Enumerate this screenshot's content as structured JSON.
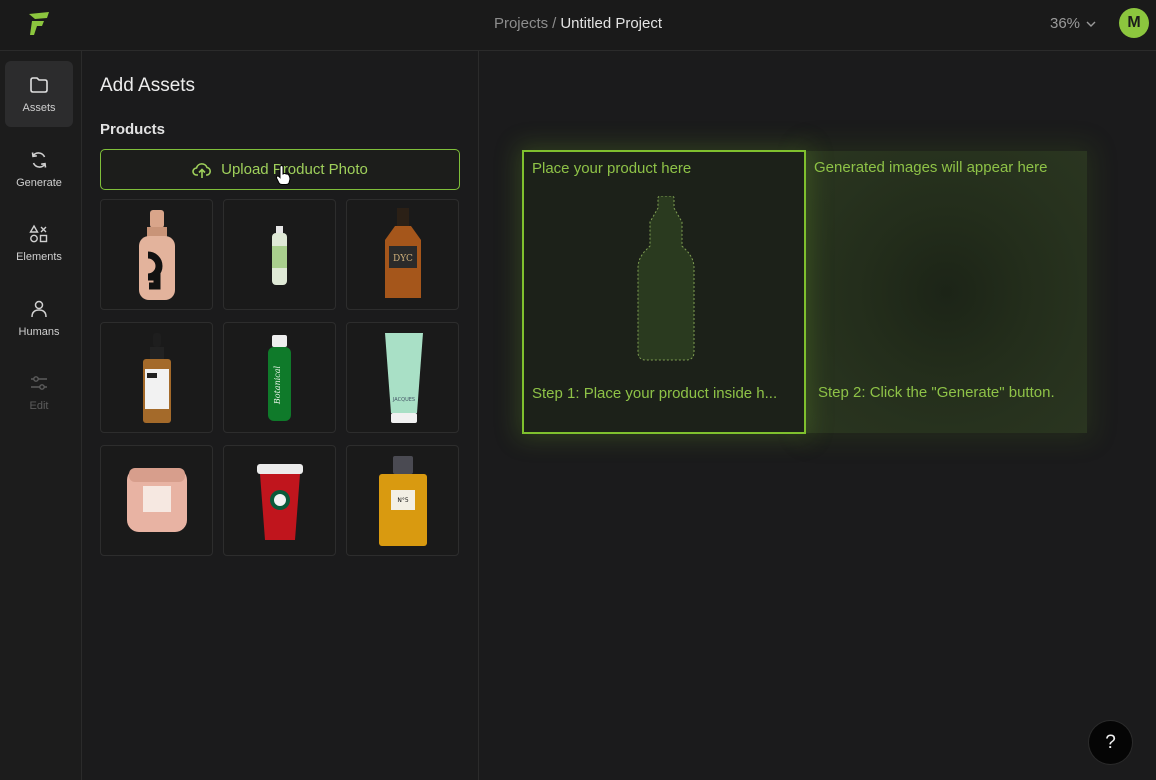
{
  "header": {
    "breadcrumb_root": "Projects",
    "breadcrumb_separator": "/",
    "breadcrumb_current": "Untitled Project",
    "zoom": "36%",
    "avatar_initial": "M",
    "accent_color": "#8cc63e"
  },
  "sidebar": {
    "items": [
      {
        "label": "Assets",
        "icon": "folder-icon",
        "active": true
      },
      {
        "label": "Generate",
        "icon": "refresh-icon"
      },
      {
        "label": "Elements",
        "icon": "shapes-icon"
      },
      {
        "label": "Humans",
        "icon": "person-icon"
      },
      {
        "label": "Edit",
        "icon": "sliders-icon",
        "disabled": true
      }
    ]
  },
  "panel": {
    "title": "Add Assets",
    "section": "Products",
    "upload_label": "Upload Product Photo",
    "products": [
      "foundation-bottle",
      "spray-bottle",
      "whisky-bottle",
      "dropper-serum",
      "green-toner-bottle",
      "mint-cream-tube",
      "pink-candle",
      "red-coffee-cup",
      "perfume-bottle"
    ]
  },
  "canvas": {
    "placeholder_label": "Place your product here",
    "step1": "Step 1: Place your product inside h...",
    "generated_label": "Generated images will appear here",
    "step2": "Step 2: Click the \"Generate\" button."
  },
  "help_label": "?"
}
